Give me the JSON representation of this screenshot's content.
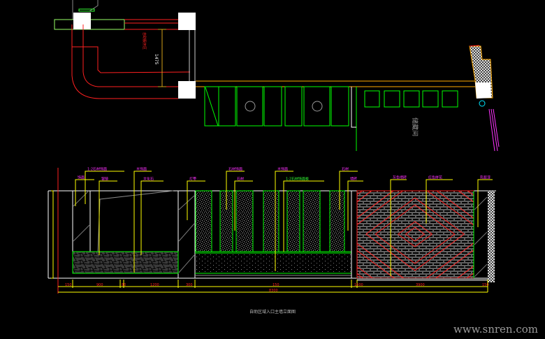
{
  "drawing": {
    "caption": "自助区域入口主墙立面图",
    "watermark": "www.snren.com",
    "plan": {
      "room_label": "储藏间",
      "zone_label": "自助服务区",
      "dimension_1475": "1475"
    },
    "labels_row1": [
      "1:2石材饰面",
      "木饰面",
      "石材饰面",
      "木饰面",
      "石材"
    ],
    "labels_row2": [
      "银镜",
      "文化石",
      "灯带",
      "石材",
      "1:2石材饰面板",
      "墙砖"
    ],
    "labels_row3": [
      "灰色墙砖",
      "红色拼花",
      "乳胶漆",
      "饰面"
    ],
    "dimension_labels": [
      "150",
      "900",
      "80",
      "1200",
      "300",
      "150",
      "1500",
      "3900",
      "150"
    ],
    "overall_dimension": "8300",
    "colors": {
      "background": "#000000",
      "wall": "#ffffff",
      "pipe": "#ff2020",
      "leader": "#ffff00",
      "furniture": "#00ff00",
      "label": "#ff33ff",
      "beam": "#ffaa00"
    }
  }
}
